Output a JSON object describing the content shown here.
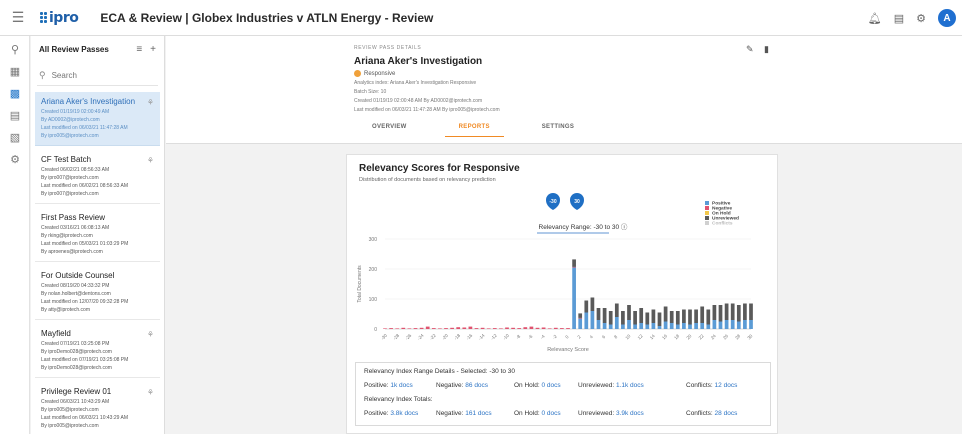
{
  "app": {
    "logo_text": "ipro",
    "title": "ECA & Review | Globex Industries v ATLN Energy - Review",
    "avatar_letter": "A"
  },
  "icons": {
    "menu": "menu-icon",
    "bell": "bell-icon",
    "notes": "notes-icon",
    "settings": "gear-icon",
    "rail": [
      "search-icon",
      "document-icon",
      "review-icon",
      "screen-icon",
      "file-icon",
      "gear-icon"
    ]
  },
  "passes": {
    "title": "All Review Passes",
    "search_placeholder": "Search",
    "items": [
      {
        "name": "Ariana Aker's Investigation",
        "created": "Created 01/19/19 02:00:49 AM",
        "by": "By AD0002@iprotech.com",
        "modified": "Last modified on 06/03/21 11:47:28 AM",
        "modified_by": "By ipro005@iprotech.com",
        "selected": true,
        "star": true
      },
      {
        "name": "CF Test Batch",
        "created": "Created 06/02/21 08:56:33 AM",
        "by": "By ipro007@iprotech.com",
        "modified": "Last modified on 06/02/21 08:56:33 AM",
        "modified_by": "By ipro007@iprotech.com",
        "selected": false,
        "star": true
      },
      {
        "name": "First Pass Review",
        "created": "Created 03/16/21 06:08:13 AM",
        "by": "By rking@iprotech.com",
        "modified": "Last modified on 05/03/21 01:03:29 PM",
        "modified_by": "By aproenes@iprotech.com",
        "selected": false,
        "star": false
      },
      {
        "name": "For Outside Counsel",
        "created": "Created 08/19/20 04:33:32 PM",
        "by": "By nolan.holbert@dentons.com",
        "modified": "Last modified on 12/07/20 09:32:28 PM",
        "modified_by": "By atty@iprotech.com",
        "selected": false,
        "star": false
      },
      {
        "name": "Mayfield",
        "created": "Created 07/19/21 03:25:08 PM",
        "by": "By iproDemo028@iprotech.com",
        "modified": "Last modified on 07/19/21 03:25:08 PM",
        "modified_by": "By iproDemo028@iprotech.com",
        "selected": false,
        "star": true
      },
      {
        "name": "Privilege Review 01",
        "created": "Created 06/03/21 10:43:29 AM",
        "by": "By ipro005@iprotech.com",
        "modified": "Last modified on 06/03/21 10:43:29 AM",
        "modified_by": "By ipro005@iprotech.com",
        "selected": false,
        "star": true
      }
    ]
  },
  "details": {
    "section_label": "REVIEW PASS DETAILS",
    "title": "Ariana Aker's Investigation",
    "tag": "Responsive",
    "lines": [
      "Analytics index: Ariana Aker's Investigation Responsive",
      "Batch Size: 10",
      "Created 01/19/19 02:00:48 AM By AD0002@iprotech.com",
      "Last modified on 06/03/21 11:47:28 AM By ipro005@iprotech.com"
    ],
    "tabs": [
      {
        "label": "OVERVIEW",
        "active": false
      },
      {
        "label": "REPORTS",
        "active": true
      },
      {
        "label": "SETTINGS",
        "active": false
      }
    ]
  },
  "report": {
    "title": "Relevancy Scores for Responsive",
    "subtitle": "Distribution of documents based on relevancy prediction",
    "range_label": "Relevancy Range: -30 to 30",
    "slider_min": "-30",
    "slider_max": "30",
    "summary": {
      "range_title": "Relevancy Index Range Details - Selected: -30 to 30",
      "range_row": [
        {
          "label": "Positive:",
          "value": "1k docs"
        },
        {
          "label": "Negative:",
          "value": "86 docs"
        },
        {
          "label": "On Hold:",
          "value": "0 docs"
        },
        {
          "label": "Unreviewed:",
          "value": "1.1k docs"
        },
        {
          "label": "Conflicts:",
          "value": "12 docs"
        }
      ],
      "totals_title": "Relevancy Index Totals:",
      "totals_row": [
        {
          "label": "Positive:",
          "value": "3.8k docs"
        },
        {
          "label": "Negative:",
          "value": "161 docs"
        },
        {
          "label": "On Hold:",
          "value": "0 docs"
        },
        {
          "label": "Unreviewed:",
          "value": "3.9k docs"
        },
        {
          "label": "Conflicts:",
          "value": "28 docs"
        }
      ]
    }
  },
  "chart_data": {
    "type": "bar",
    "stacked": true,
    "title": "Relevancy Scores for Responsive",
    "xlabel": "Relevancy Score",
    "ylabel": "Total Documents",
    "ylim": [
      0,
      300
    ],
    "yticks": [
      0,
      100,
      200,
      300
    ],
    "legend_position": "top-right",
    "categories": [
      -30,
      -28,
      -26,
      -24,
      -22,
      -20,
      -18,
      -16,
      -14,
      -12,
      -10,
      -8,
      -6,
      -4,
      -2,
      0,
      2,
      4,
      6,
      8,
      10,
      12,
      14,
      16,
      18,
      20,
      22,
      24,
      26,
      28,
      30
    ],
    "x": [
      -30,
      -29,
      -28,
      -27,
      -26,
      -25,
      -24,
      -23,
      -22,
      -21,
      -20,
      -19,
      -18,
      -17,
      -16,
      -15,
      -14,
      -13,
      -12,
      -11,
      -10,
      -9,
      -8,
      -7,
      -6,
      -5,
      -4,
      -3,
      -2,
      -1,
      0,
      1,
      2,
      3,
      4,
      5,
      6,
      7,
      8,
      9,
      10,
      11,
      12,
      13,
      14,
      15,
      16,
      17,
      18,
      19,
      20,
      21,
      22,
      23,
      24,
      25,
      26,
      27,
      28,
      29,
      30
    ],
    "series": [
      {
        "name": "Positive",
        "color": "#5b9bd5",
        "values": [
          0,
          0,
          0,
          0,
          0,
          0,
          0,
          0,
          0,
          0,
          0,
          0,
          0,
          0,
          0,
          0,
          0,
          0,
          0,
          0,
          0,
          0,
          0,
          0,
          0,
          0,
          0,
          0,
          0,
          0,
          0,
          205,
          35,
          55,
          60,
          30,
          20,
          15,
          40,
          15,
          30,
          15,
          20,
          15,
          20,
          10,
          25,
          20,
          15,
          20,
          15,
          20,
          20,
          15,
          30,
          25,
          30,
          30,
          25,
          30,
          30
        ]
      },
      {
        "name": "Negative",
        "color": "#e0536f",
        "values": [
          2,
          3,
          2,
          4,
          2,
          3,
          4,
          8,
          3,
          2,
          3,
          4,
          6,
          5,
          8,
          3,
          4,
          2,
          3,
          2,
          5,
          4,
          3,
          6,
          8,
          4,
          5,
          2,
          4,
          3,
          3,
          2,
          2,
          0,
          0,
          0,
          0,
          0,
          0,
          0,
          0,
          0,
          0,
          0,
          0,
          0,
          0,
          0,
          0,
          0,
          0,
          0,
          0,
          0,
          0,
          0,
          0,
          0,
          0,
          0,
          0
        ]
      },
      {
        "name": "On Hold",
        "color": "#f2c84b",
        "values": [
          0,
          0,
          0,
          0,
          0,
          0,
          0,
          0,
          0,
          0,
          0,
          0,
          0,
          0,
          0,
          0,
          0,
          0,
          0,
          0,
          0,
          0,
          0,
          0,
          0,
          0,
          0,
          0,
          0,
          0,
          0,
          0,
          0,
          0,
          0,
          0,
          0,
          0,
          0,
          0,
          0,
          0,
          0,
          0,
          0,
          0,
          0,
          0,
          0,
          0,
          0,
          0,
          0,
          0,
          0,
          0,
          0,
          0,
          0,
          0,
          0
        ]
      },
      {
        "name": "Unreviewed",
        "color": "#5a5a5a",
        "values": [
          0,
          0,
          0,
          0,
          0,
          0,
          0,
          0,
          0,
          0,
          0,
          0,
          0,
          0,
          0,
          0,
          0,
          0,
          0,
          0,
          0,
          0,
          0,
          0,
          0,
          0,
          0,
          0,
          0,
          0,
          0,
          25,
          15,
          40,
          45,
          40,
          50,
          45,
          45,
          45,
          50,
          45,
          50,
          40,
          45,
          45,
          50,
          40,
          45,
          45,
          50,
          45,
          55,
          50,
          50,
          55,
          55,
          55,
          55,
          55,
          55
        ]
      },
      {
        "name": "Conflicts",
        "color": "#d0d0d0",
        "values": [
          0,
          0,
          0,
          0,
          0,
          0,
          0,
          0,
          0,
          0,
          0,
          0,
          0,
          0,
          0,
          0,
          0,
          0,
          0,
          0,
          0,
          0,
          0,
          0,
          0,
          0,
          0,
          0,
          0,
          0,
          0,
          0,
          0,
          0,
          0,
          0,
          0,
          0,
          0,
          0,
          0,
          0,
          0,
          0,
          0,
          0,
          0,
          0,
          0,
          0,
          0,
          0,
          0,
          0,
          0,
          0,
          0,
          0,
          0,
          0,
          0
        ]
      }
    ]
  }
}
